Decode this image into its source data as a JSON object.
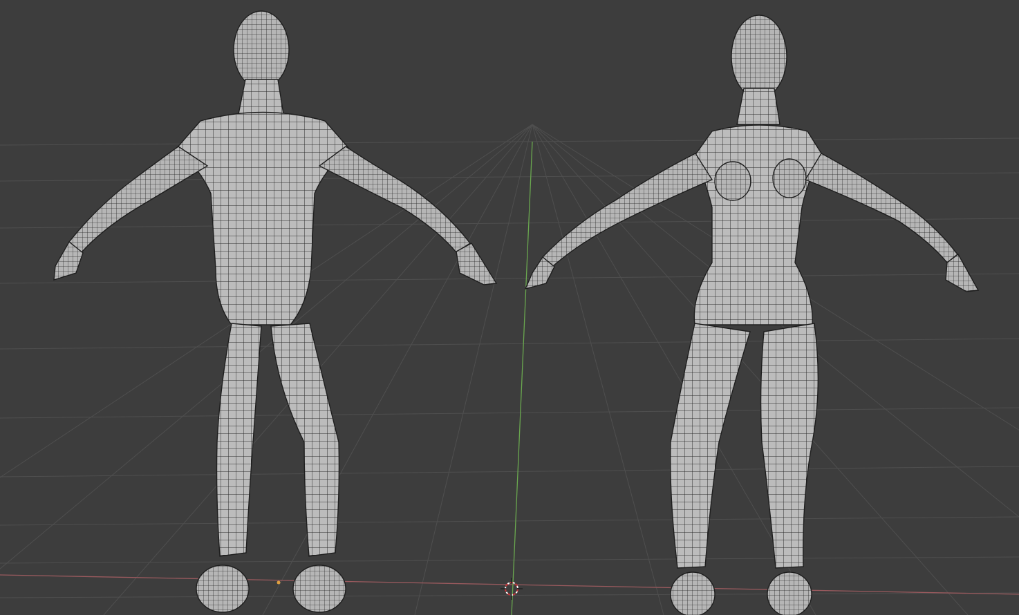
{
  "app": {
    "view": "3d-viewport",
    "shading": "solid-wireframe"
  },
  "viewport": {
    "background_color": "#3d3d3d",
    "grid_color": "#525252",
    "x_axis_color": "#9a5a5e",
    "y_axis_color": "#6aa84f",
    "cursor_color": "#c8373a",
    "mesh_fill": "#b4b4b4",
    "mesh_shadow": "#8c8c8c",
    "wire_color": "#1e1e1e"
  },
  "objects": [
    {
      "name": "male-base-mesh",
      "selected": false
    },
    {
      "name": "female-base-mesh",
      "selected": false
    }
  ],
  "cursor_3d": {
    "icon": "3d-cursor-icon"
  },
  "origin": {
    "icon": "origin-dot-icon"
  }
}
